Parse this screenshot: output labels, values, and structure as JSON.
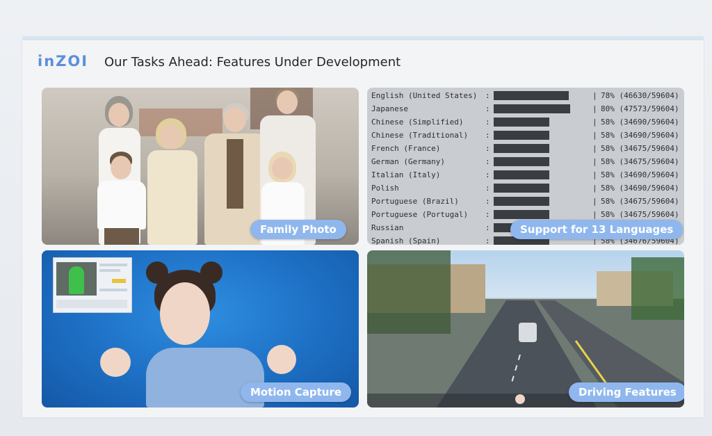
{
  "slide": {
    "logo": "inZOI",
    "title": "Our Tasks Ahead: Features Under Development"
  },
  "panels": {
    "family_photo": {
      "caption": "Family Photo"
    },
    "languages": {
      "caption": "Support for 13 Languages",
      "rows": [
        {
          "name": "English (United States)",
          "percent": 78,
          "label": "78% (46630/59604)"
        },
        {
          "name": "Japanese",
          "percent": 80,
          "label": "80% (47573/59604)"
        },
        {
          "name": "Chinese (Simplified)",
          "percent": 58,
          "label": "58% (34690/59604)"
        },
        {
          "name": "Chinese (Traditional)",
          "percent": 58,
          "label": "58% (34690/59604)"
        },
        {
          "name": "French (France)",
          "percent": 58,
          "label": "58% (34675/59604)"
        },
        {
          "name": "German (Germany)",
          "percent": 58,
          "label": "58% (34675/59604)"
        },
        {
          "name": "Italian (Italy)",
          "percent": 58,
          "label": "58% (34690/59604)"
        },
        {
          "name": "Polish",
          "percent": 58,
          "label": "58% (34690/59604)"
        },
        {
          "name": "Portuguese (Brazil)",
          "percent": 58,
          "label": "58% (34675/59604)"
        },
        {
          "name": "Portuguese (Portugal)",
          "percent": 58,
          "label": "58% (34675/59604)"
        },
        {
          "name": "Russian",
          "percent": 58,
          "label": ""
        },
        {
          "name": "Spanish (Spain)",
          "percent": 58,
          "label": "58% (34676/59604)"
        }
      ]
    },
    "motion_capture": {
      "caption": "Motion Capture"
    },
    "driving": {
      "caption": "Driving Features"
    }
  },
  "colors": {
    "accent": "#5b8fd8",
    "caption_pill": "#8fb7ee",
    "bar": "#3a3d42"
  }
}
